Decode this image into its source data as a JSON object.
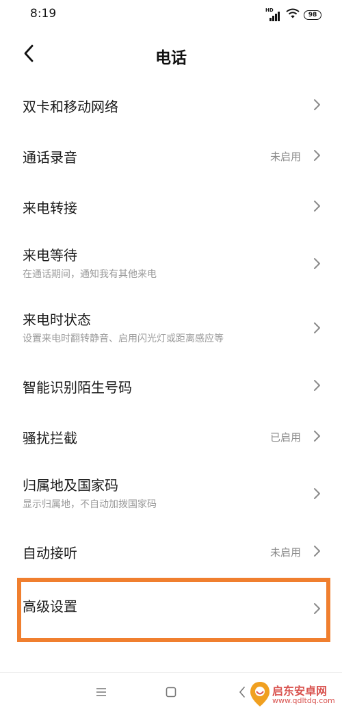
{
  "status_bar": {
    "time": "8:19",
    "network_label": "HD",
    "battery": "98"
  },
  "header": {
    "title": "电话",
    "back_icon": "chevron-left-icon"
  },
  "items": [
    {
      "title": "双卡和移动网络",
      "subtitle": "",
      "status": ""
    },
    {
      "title": "通话录音",
      "subtitle": "",
      "status": "未启用"
    },
    {
      "title": "来电转接",
      "subtitle": "",
      "status": ""
    },
    {
      "title": "来电等待",
      "subtitle": "在通话期间，通知我有其他来电",
      "status": ""
    },
    {
      "title": "来电时状态",
      "subtitle": "设置来电时翻转静音、启用闪光灯或距离感应等",
      "status": ""
    },
    {
      "title": "智能识别陌生号码",
      "subtitle": "",
      "status": ""
    },
    {
      "title": "骚扰拦截",
      "subtitle": "",
      "status": "已启用"
    },
    {
      "title": "归属地及国家码",
      "subtitle": "显示归属地，不自动加拨国家码",
      "status": ""
    },
    {
      "title": "自动接听",
      "subtitle": "",
      "status": "未启用"
    },
    {
      "title": "高级设置",
      "subtitle": "",
      "status": ""
    }
  ],
  "highlight": {
    "color": "#F07F2F",
    "target": "高级设置"
  },
  "nav_bar": {
    "icons": [
      "menu-icon",
      "home-icon",
      "back-icon"
    ]
  },
  "watermark": {
    "line1": "启东安卓网",
    "line2": "www.qdltdq.com"
  }
}
